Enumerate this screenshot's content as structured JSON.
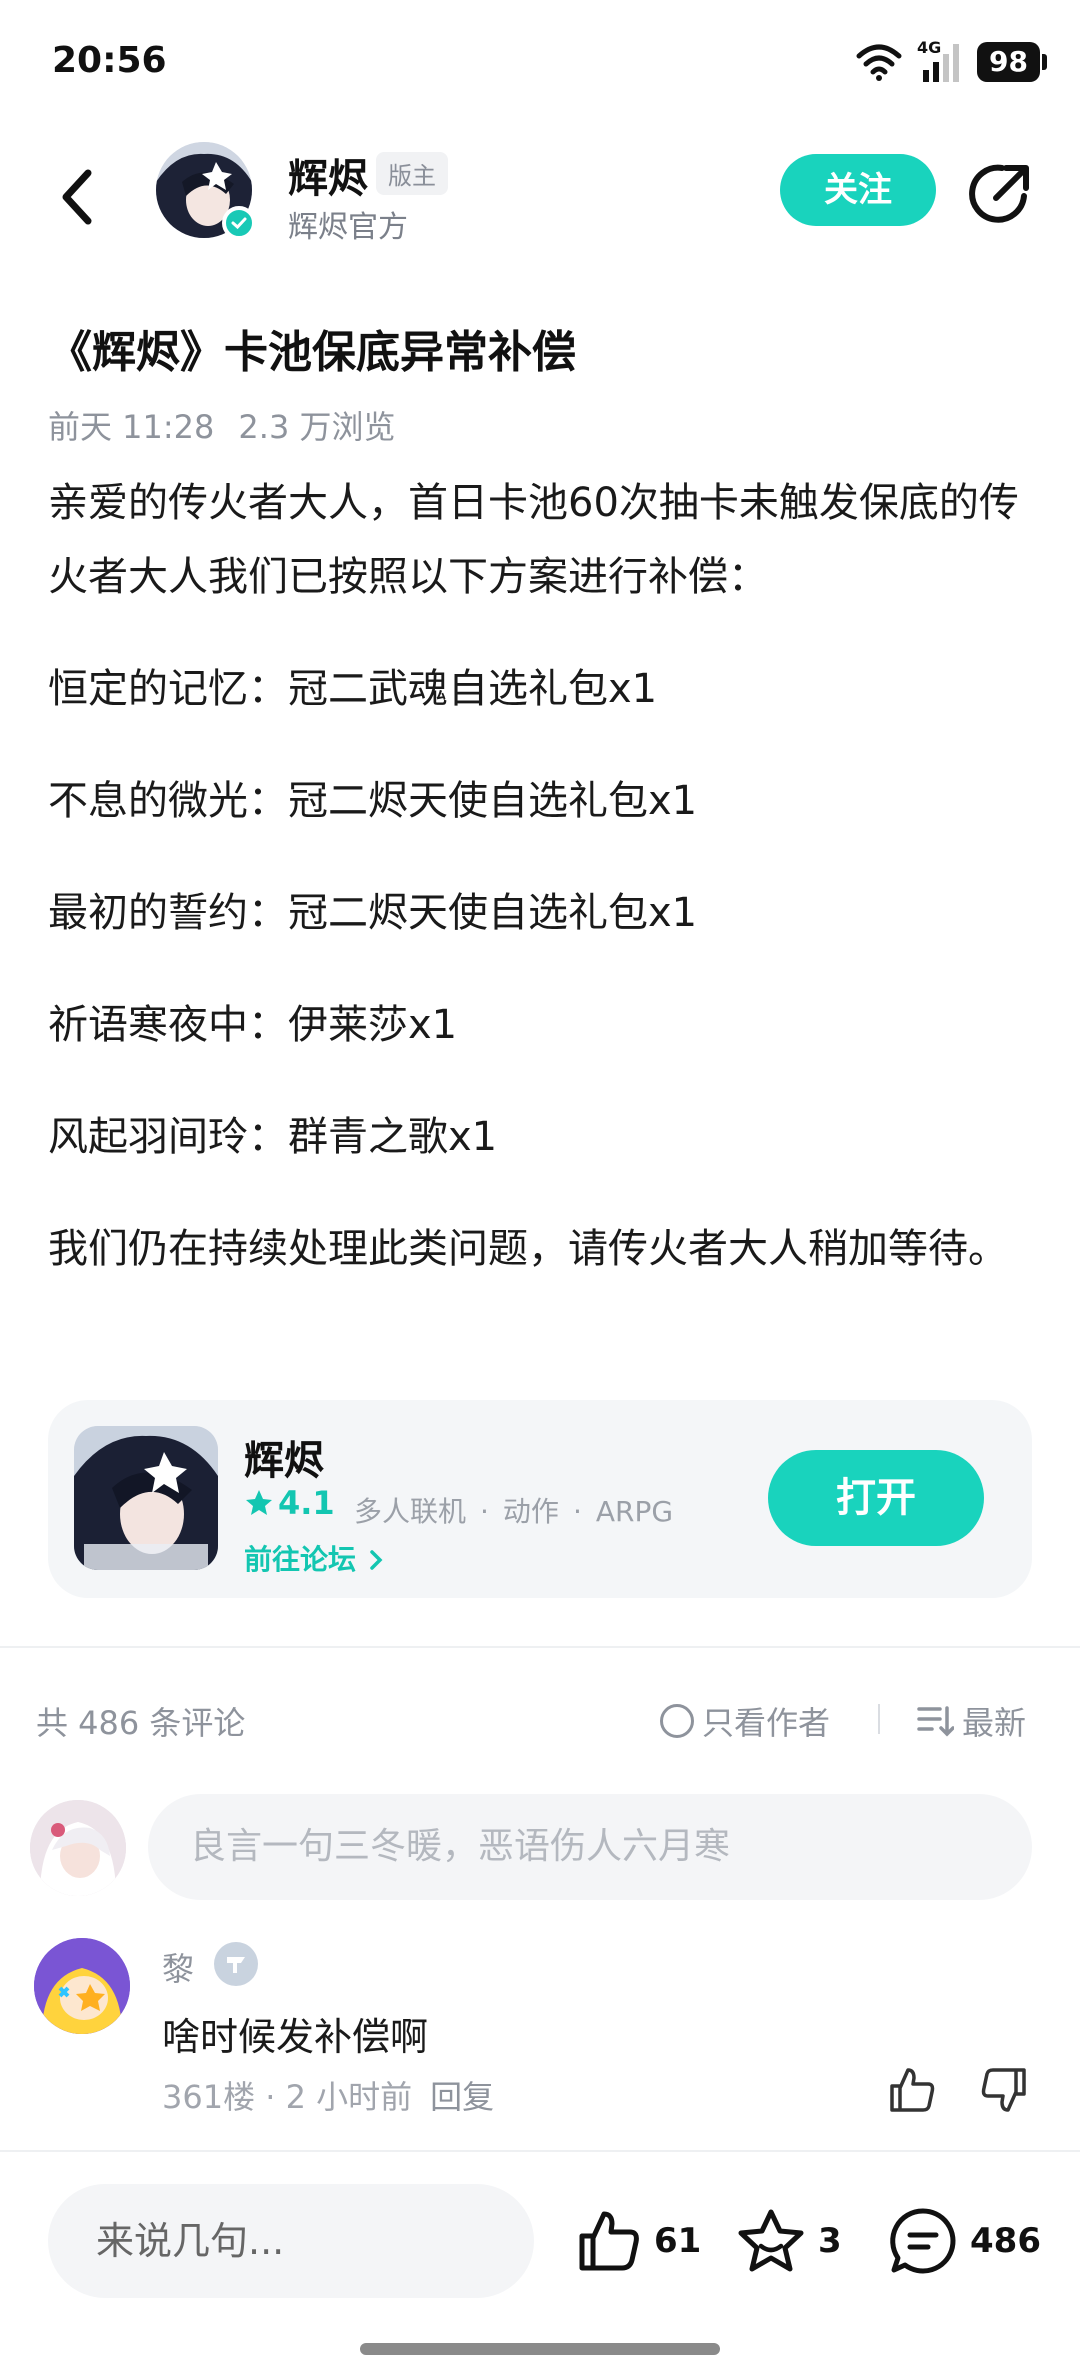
{
  "status_bar": {
    "time": "20:56",
    "network": "4G",
    "battery": "98"
  },
  "header": {
    "author_name": "辉烬",
    "role_badge": "版主",
    "author_subtitle": "辉烬官方",
    "follow_label": "关注"
  },
  "post": {
    "title": "《辉烬》卡池保底异常补偿",
    "time": "前天 11:28",
    "views": "2.3 万浏览",
    "paragraphs": [
      "亲爱的传火者大人，首日卡池60次抽卡未触发保底的传火者大人我们已按照以下方案进行补偿：",
      "恒定的记忆：冠二武魂自选礼包x1",
      "不息的微光：冠二烬天使自选礼包x1",
      "最初的誓约：冠二烬天使自选礼包x1",
      "祈语寒夜中：伊莱莎x1",
      "风起羽间玲：群青之歌x1",
      "我们仍在持续处理此类问题，请传火者大人稍加等待。"
    ]
  },
  "game_card": {
    "name": "辉烬",
    "rating": "4.1",
    "tags": [
      "多人联机",
      "动作",
      "ARPG"
    ],
    "forum_link": "前往论坛",
    "open_label": "打开"
  },
  "comments_header": {
    "count_text": "共 486 条评论",
    "author_only": "只看作者",
    "sort": "最新"
  },
  "comment_input_placeholder": "良言一句三冬暖，恶语伤人六月寒",
  "comment": {
    "user": "黎",
    "text": "啥时候发补偿啊",
    "floor": "361楼",
    "time": "2 小时前",
    "reply": "回复"
  },
  "bottom_bar": {
    "input_placeholder": "来说几句...",
    "likes": "61",
    "favorites": "3",
    "comments": "486"
  },
  "colors": {
    "accent": "#19d3bd",
    "text": "#111111",
    "muted": "#8e939c"
  }
}
